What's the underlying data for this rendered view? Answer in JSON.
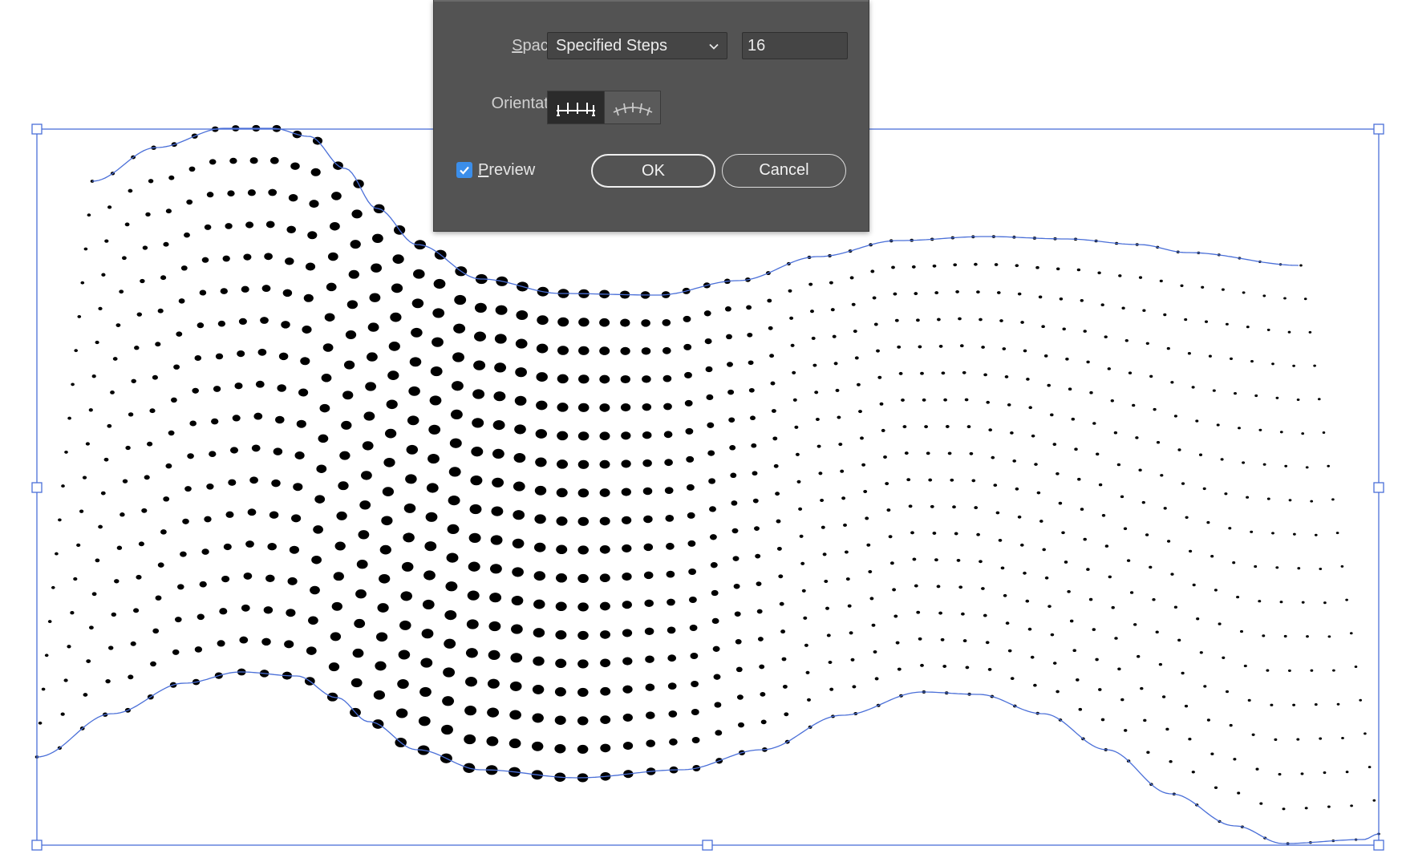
{
  "dialog": {
    "spacing_label": "Spacing:",
    "spacing_value": "Specified Steps",
    "steps_value": "16",
    "orientation_label": "Orientation:",
    "preview_label": "Preview",
    "preview_checked": true,
    "ok_label": "OK",
    "cancel_label": "Cancel",
    "orientation_selected": "align-to-page"
  },
  "icons": {
    "dropdown": "chevron-down-icon",
    "orient_page": "align-to-page-icon",
    "orient_path": "align-to-path-icon",
    "checkbox": "checkmark-icon"
  },
  "artwork": {
    "blend_steps": 16,
    "dot_color": "#000000",
    "path_color": "#4a6fd8",
    "selection_color": "#4a6fd8"
  },
  "colors": {
    "dialog_bg": "#535353",
    "field_bg": "#454545",
    "checkbox_accent": "#3b8eea"
  }
}
